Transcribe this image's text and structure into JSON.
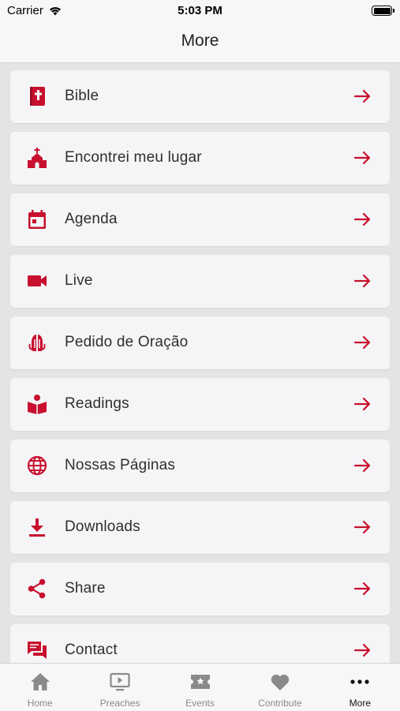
{
  "status": {
    "carrier": "Carrier",
    "time": "5:03 PM"
  },
  "header": {
    "title": "More"
  },
  "accent_color": "#c8102e",
  "menu": [
    {
      "label": "Bible",
      "icon": "bible-icon"
    },
    {
      "label": "Encontrei meu lugar",
      "icon": "church-icon"
    },
    {
      "label": "Agenda",
      "icon": "calendar-icon"
    },
    {
      "label": "Live",
      "icon": "video-camera-icon"
    },
    {
      "label": "Pedido de Oração",
      "icon": "praying-hands-icon"
    },
    {
      "label": "Readings",
      "icon": "book-reader-icon"
    },
    {
      "label": "Nossas Páginas",
      "icon": "globe-icon"
    },
    {
      "label": "Downloads",
      "icon": "download-icon"
    },
    {
      "label": "Share",
      "icon": "share-icon"
    },
    {
      "label": "Contact",
      "icon": "chat-icon"
    }
  ],
  "tabs": [
    {
      "label": "Home",
      "icon": "home-icon",
      "active": false
    },
    {
      "label": "Preaches",
      "icon": "play-screen-icon",
      "active": false
    },
    {
      "label": "Events",
      "icon": "ticket-icon",
      "active": false
    },
    {
      "label": "Contribute",
      "icon": "heart-icon",
      "active": false
    },
    {
      "label": "More",
      "icon": "more-icon",
      "active": true
    }
  ]
}
